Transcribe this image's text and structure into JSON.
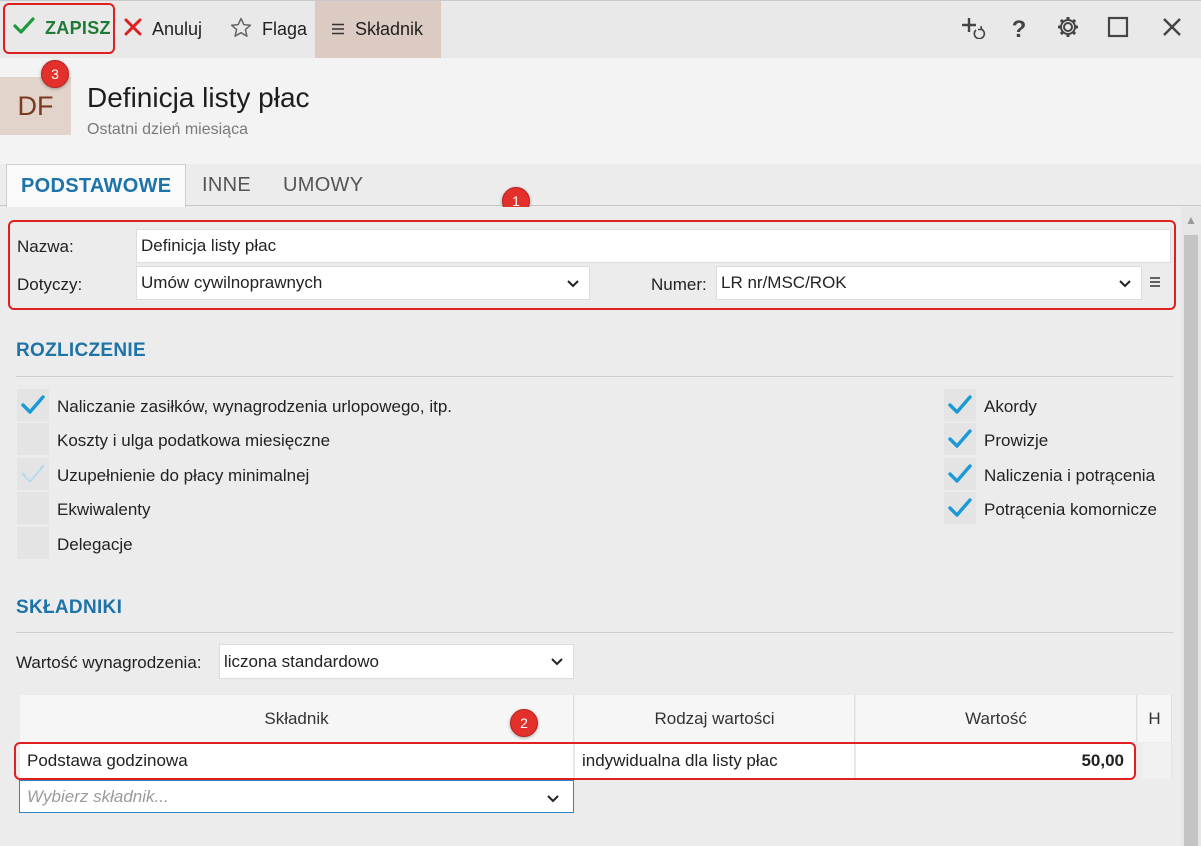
{
  "toolbar": {
    "save_label": "ZAPISZ",
    "cancel_label": "Anuluj",
    "flag_label": "Flaga",
    "component_label": "Składnik",
    "help_glyph": "?"
  },
  "badges": {
    "one": "1",
    "two": "2",
    "three": "3"
  },
  "header": {
    "logo": "DF",
    "title": "Definicja listy płac",
    "subtitle": "Ostatni dzień miesiąca"
  },
  "tabs": [
    {
      "label": "PODSTAWOWE"
    },
    {
      "label": "INNE"
    },
    {
      "label": "UMOWY"
    }
  ],
  "form": {
    "name_label": "Nazwa:",
    "name_value": "Definicja listy płac",
    "concerns_label": "Dotyczy:",
    "concerns_value": "Umów cywilnoprawnych",
    "number_label": "Numer:",
    "number_value": "LR nr/MSC/ROK"
  },
  "settlement": {
    "title": "ROZLICZENIE",
    "left": [
      {
        "label": "Naliczanie zasiłków, wynagrodzenia urlopowego, itp.",
        "state": "checked"
      },
      {
        "label": "Koszty i ulga podatkowa miesięczne",
        "state": "unchecked"
      },
      {
        "label": "Uzupełnienie do płacy minimalnej",
        "state": "checked-faded"
      },
      {
        "label": "Ekwiwalenty",
        "state": "unchecked"
      },
      {
        "label": "Delegacje",
        "state": "unchecked"
      }
    ],
    "right": [
      {
        "label": "Akordy",
        "state": "checked"
      },
      {
        "label": "Prowizje",
        "state": "checked"
      },
      {
        "label": "Naliczenia i potrącenia",
        "state": "checked"
      },
      {
        "label": "Potrącenia komornicze",
        "state": "checked"
      }
    ]
  },
  "components": {
    "title": "SKŁADNIKI",
    "salary_label": "Wartość wynagrodzenia:",
    "salary_value": "liczona standardowo",
    "columns": [
      "Składnik",
      "Rodzaj wartości",
      "Wartość",
      "H"
    ],
    "rows": [
      {
        "component": "Podstawa godzinowa",
        "value_type": "indywidualna dla listy płac",
        "value": "50,00"
      }
    ],
    "picker_placeholder": "Wybierz składnik..."
  },
  "colors": {
    "accent": "#1e73a8",
    "highlight": "#e02020",
    "check": "#1a9ad6",
    "save_green": "#1f7a35"
  }
}
